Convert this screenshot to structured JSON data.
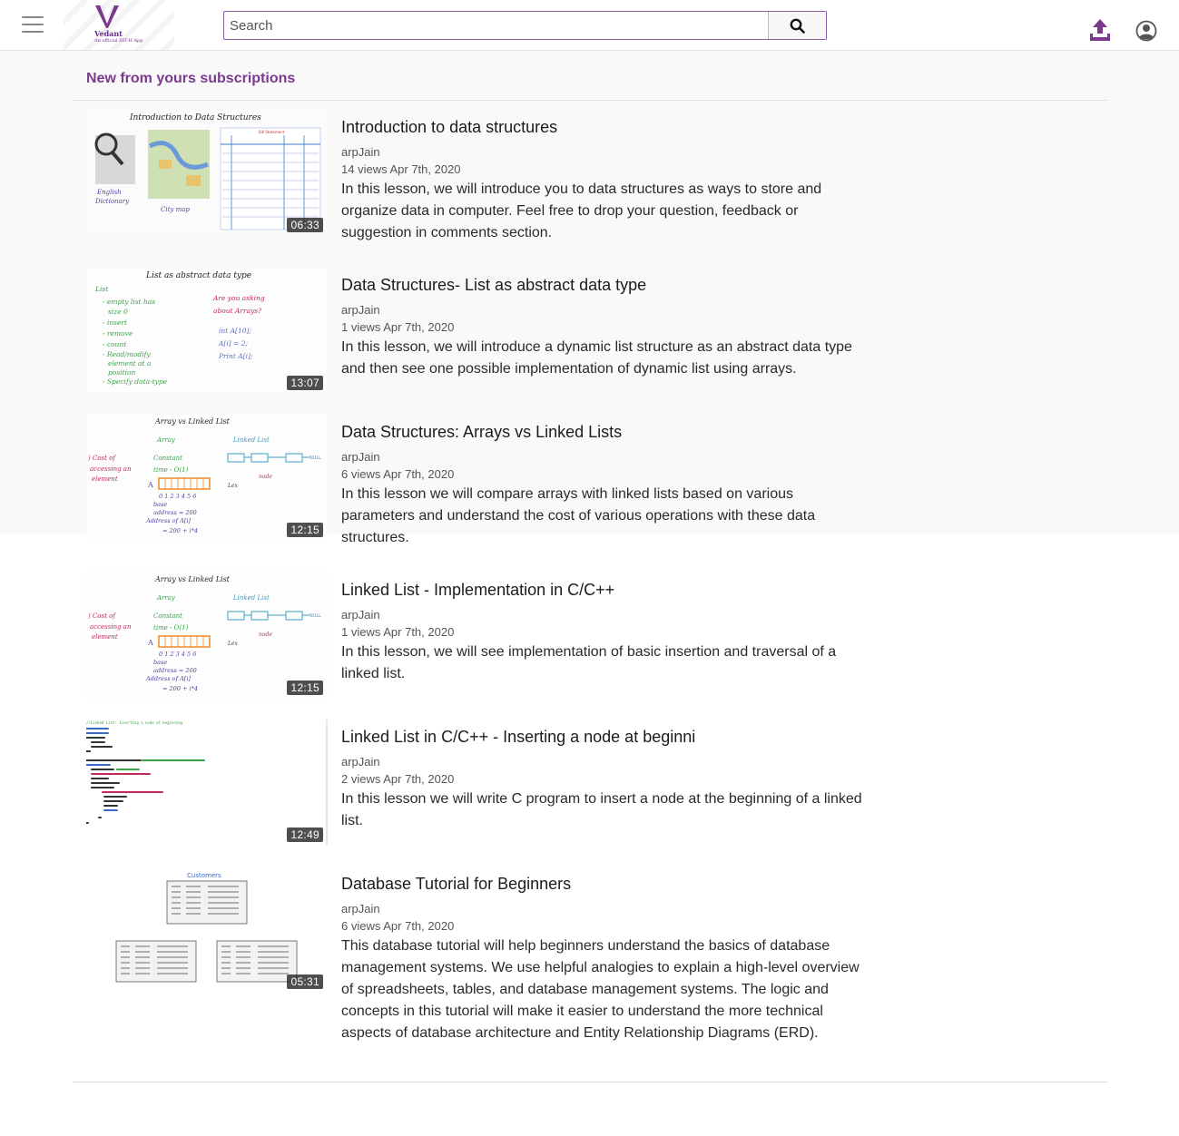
{
  "header": {
    "logo_name": "Vedant",
    "logo_tagline": "An official IIIT-H App",
    "search_placeholder": "Search"
  },
  "section": {
    "title": "New from yours subscriptions"
  },
  "videos": [
    {
      "title": "Introduction to data structures",
      "author": "arpJain",
      "meta": "14 views Apr 7th, 2020",
      "description": "In this lesson, we will introduce you to data structures as ways to store and organize data in computer. Feel free to drop your question, feedback or suggestion in comments section.",
      "duration": "06:33",
      "thumb_heading": "Introduction to Data Structures"
    },
    {
      "title": "Data Structures- List as abstract data type",
      "author": "arpJain",
      "meta": "1 views Apr 7th, 2020",
      "description": "In this lesson, we will introduce a dynamic list structure as an abstract data type and then see one possible implementation of dynamic list using arrays.",
      "duration": "13:07",
      "thumb_heading": "List as abstract data type"
    },
    {
      "title": "Data Structures: Arrays vs Linked Lists",
      "author": "arpJain",
      "meta": "6 views Apr 7th, 2020",
      "description": "In this lesson we will compare arrays with linked lists based on various parameters and understand the cost of various operations with these data structures.",
      "duration": "12:15",
      "thumb_heading": "Array vs Linked List"
    },
    {
      "title": "Linked List - Implementation in C/C++",
      "author": "arpJain",
      "meta": "1 views Apr 7th, 2020",
      "description": "In this lesson, we will see implementation of basic insertion and traversal of a linked list.",
      "duration": "12:15",
      "thumb_heading": "Array vs Linked List"
    },
    {
      "title": "Linked List in C/C++ - Inserting a node at beginni",
      "author": "arpJain",
      "meta": "2 views Apr 7th, 2020",
      "description": "In this lesson we will write C program to insert a node at the beginning of a linked list.",
      "duration": "12:49",
      "thumb_heading": "//Linked List: Inserting a node at beginning"
    },
    {
      "title": "Database Tutorial for Beginners",
      "author": "arpJain",
      "meta": "6 views Apr 7th, 2020",
      "description": "This database tutorial will help beginners understand the basics of database management systems. We use helpful analogies to explain a high-level overview of spreadsheets, tables, and database management systems. The logic and concepts in this tutorial will make it easier to understand the more technical aspects of database architecture and Entity Relationship Diagrams (ERD).",
      "duration": "05:31",
      "thumb_heading": "Customers"
    }
  ],
  "colors": {
    "brand": "#7b3a8e",
    "search_border": "#8a5ca3"
  }
}
